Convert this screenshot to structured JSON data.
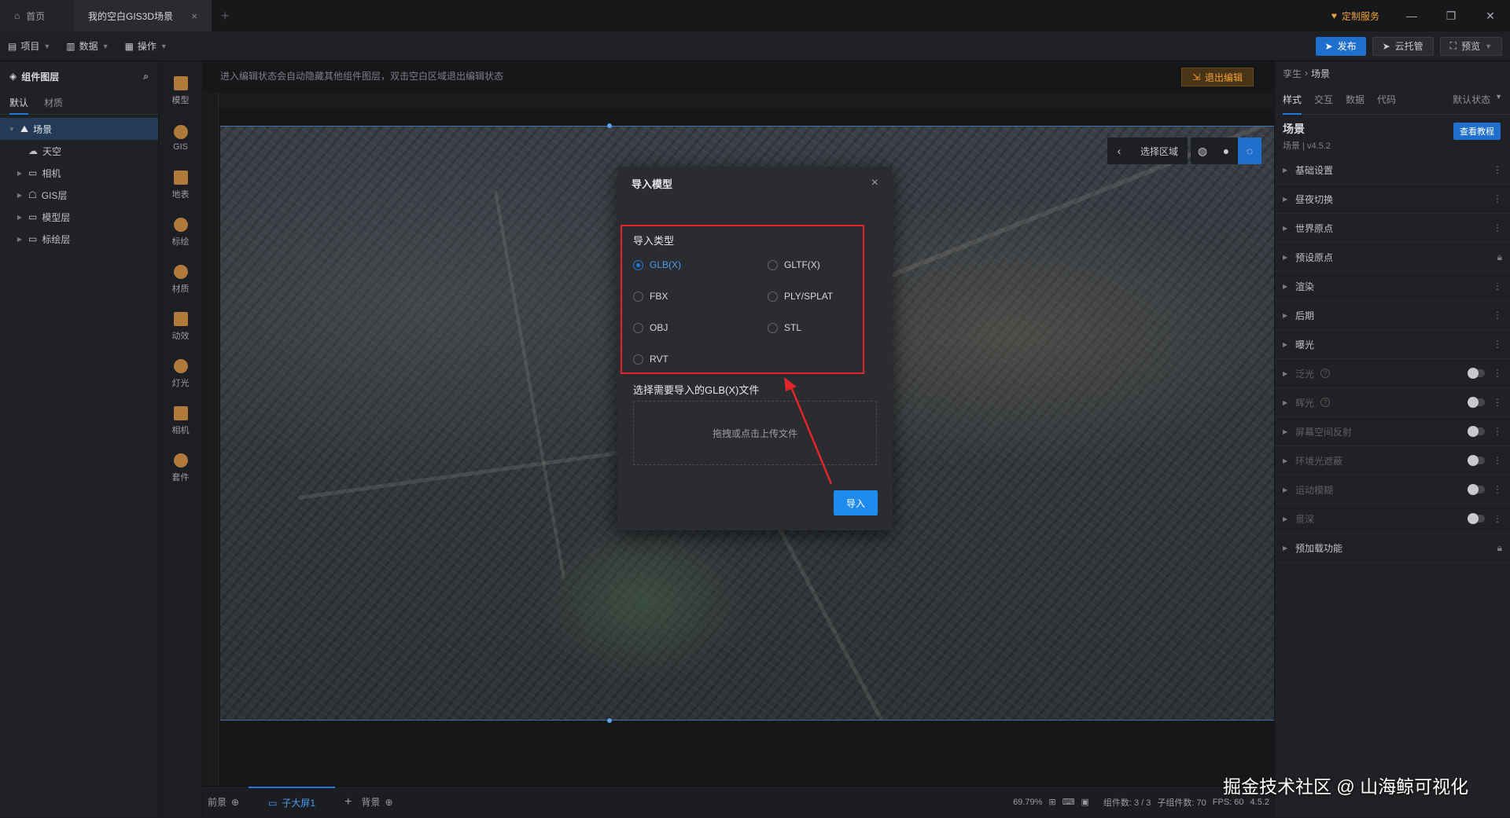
{
  "titlebar": {
    "home_tab": "首页",
    "active_tab": "我的空白GIS3D场景",
    "custom_service": "定制服务"
  },
  "toolbar": {
    "menus": [
      "项目",
      "数据",
      "操作"
    ],
    "publish": "发布",
    "cloud": "云托管",
    "preview": "预览"
  },
  "left_panel": {
    "title": "组件图层",
    "tabs": [
      "默认",
      "材质"
    ],
    "tree": [
      "场景",
      "天空",
      "相机",
      "GIS层",
      "模型层",
      "标绘层"
    ]
  },
  "icon_column": [
    "模型",
    "GIS",
    "地表",
    "标绘",
    "材质",
    "动效",
    "灯光",
    "相机",
    "套件"
  ],
  "canvas": {
    "hint": "进入编辑状态会自动隐藏其他组件图层，双击空白区域退出编辑状态",
    "exit_edit": "退出编辑",
    "select_region": "选择区域"
  },
  "modal": {
    "title": "导入模型",
    "type_label": "导入类型",
    "options": [
      "GLB(X)",
      "GLTF(X)",
      "FBX",
      "PLY/SPLAT",
      "OBJ",
      "STL",
      "RVT"
    ],
    "selected": "GLB(X)",
    "file_label": "选择需要导入的GLB(X)文件",
    "drop_text": "拖拽或点击上传文件",
    "import_btn": "导入"
  },
  "bottom_bar": {
    "front": "前景",
    "active": "子大屏1",
    "back": "背景",
    "zoom": "69.79%",
    "components": "组件数: 3 / 3",
    "sub_components": "子组件数: 70",
    "fps": "FPS: 60",
    "version": "4.5.2"
  },
  "right_panel": {
    "breadcrumb_root": "孪生",
    "breadcrumb_leaf": "场景",
    "tabs": [
      "样式",
      "交互",
      "数据",
      "代码"
    ],
    "state": "默认状态",
    "title": "场景",
    "version": "场景 | v4.5.2",
    "tutorial": "查看教程",
    "sections": [
      "基础设置",
      "昼夜切换",
      "世界原点",
      "预设原点",
      "渲染",
      "后期",
      "曝光"
    ],
    "toggle_sections": [
      "泛光",
      "辉光",
      "屏幕空间反射",
      "环境光遮蔽",
      "运动模糊",
      "景深"
    ],
    "last_section": "预加载功能"
  },
  "watermark": "掘金技术社区 @ 山海鲸可视化",
  "colors": {
    "accent": "#1f7ae0",
    "highlight_box": "#e2262a",
    "warning": "#f0a030"
  }
}
